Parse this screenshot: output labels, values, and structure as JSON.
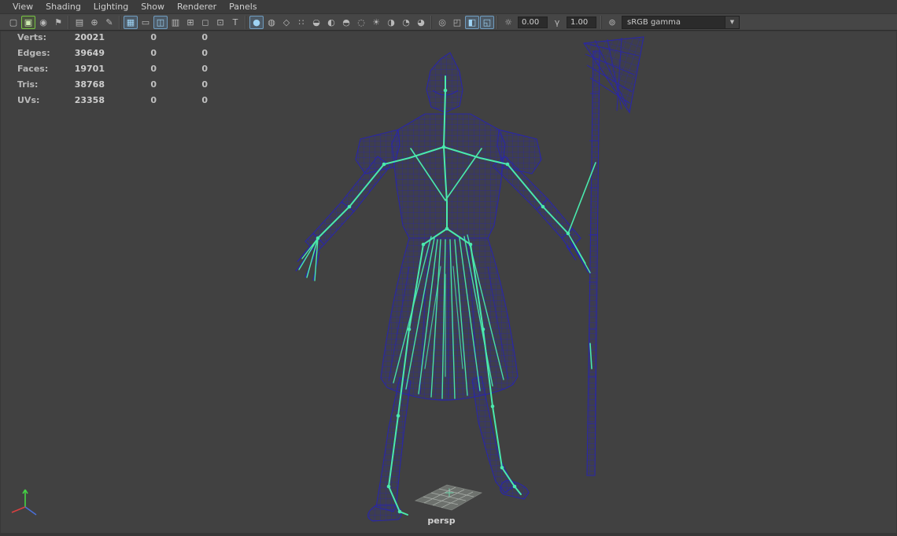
{
  "colors": {
    "viewport-bg": "#414141",
    "wire": "#2a27a6",
    "skeleton": "#4ae9ad",
    "ground": "#99a299",
    "axis-x": "#d94040",
    "axis-y": "#44d344",
    "axis-z": "#4a6fd8"
  },
  "menu": {
    "items": [
      {
        "name": "menu-view",
        "label": "View"
      },
      {
        "name": "menu-shading",
        "label": "Shading"
      },
      {
        "name": "menu-lighting",
        "label": "Lighting"
      },
      {
        "name": "menu-show",
        "label": "Show"
      },
      {
        "name": "menu-renderer",
        "label": "Renderer"
      },
      {
        "name": "menu-panels",
        "label": "Panels"
      }
    ]
  },
  "toolbar": {
    "groups": {
      "camera": [
        {
          "name": "select-camera-icon",
          "glyph": "▢"
        },
        {
          "name": "grab-view-icon",
          "glyph": "▣",
          "active": "green"
        },
        {
          "name": "camera-attributes-icon",
          "glyph": "◉"
        },
        {
          "name": "bookmark-icon",
          "glyph": "⚑"
        }
      ],
      "tools": [
        {
          "name": "image-plane-icon",
          "glyph": "▤"
        },
        {
          "name": "2d-pan-zoom-icon",
          "glyph": "⊕"
        },
        {
          "name": "pencil-icon",
          "glyph": "✎"
        }
      ],
      "gates": [
        {
          "name": "grid-icon",
          "glyph": "▦",
          "active": "blue"
        },
        {
          "name": "film-gate-icon",
          "glyph": "▭"
        },
        {
          "name": "resolution-gate-icon",
          "glyph": "◫",
          "active": "blue"
        },
        {
          "name": "gate-mask-icon",
          "glyph": "▥"
        },
        {
          "name": "field-chart-icon",
          "glyph": "⊞"
        },
        {
          "name": "safe-action-icon",
          "glyph": "◻"
        },
        {
          "name": "safe-title-icon",
          "glyph": "⊡"
        },
        {
          "name": "frame-text-icon",
          "glyph": "T"
        }
      ],
      "shading": [
        {
          "name": "smooth-shade-icon",
          "glyph": "●",
          "active": "blue"
        },
        {
          "name": "flat-shade-icon",
          "glyph": "◍"
        },
        {
          "name": "bounding-box-icon",
          "glyph": "◇"
        },
        {
          "name": "points-icon",
          "glyph": "∷"
        },
        {
          "name": "wireframe-on-shaded-icon",
          "glyph": "◒"
        },
        {
          "name": "textured-icon",
          "glyph": "◐"
        },
        {
          "name": "use-default-material-icon",
          "glyph": "◓"
        },
        {
          "name": "xray-icon",
          "glyph": "◌"
        },
        {
          "name": "lights-icon",
          "glyph": "☀"
        },
        {
          "name": "shadows-icon",
          "glyph": "◑"
        },
        {
          "name": "occlusion-icon",
          "glyph": "◔"
        },
        {
          "name": "motion-blur-icon",
          "glyph": "◕"
        }
      ],
      "layout": [
        {
          "name": "isolate-select-icon",
          "glyph": "◎"
        },
        {
          "name": "single-pane-icon",
          "glyph": "◰"
        },
        {
          "name": "split-pane-icon",
          "glyph": "◧",
          "active": "blue"
        },
        {
          "name": "quad-pane-icon",
          "glyph": "◱",
          "active": "blue"
        }
      ]
    },
    "exposure_icon": "☼",
    "exposure": "0.00",
    "gamma_icon": "γ",
    "gamma": "1.00",
    "cm_icon": "⊚",
    "colorspace": "sRGB gamma",
    "dropdown_arrow": "▼"
  },
  "hud": {
    "rows": [
      {
        "name": "hud-row-verts",
        "label": "Verts:",
        "value": "20021",
        "extra1": "0",
        "extra2": "0"
      },
      {
        "name": "hud-row-edges",
        "label": "Edges:",
        "value": "39649",
        "extra1": "0",
        "extra2": "0"
      },
      {
        "name": "hud-row-faces",
        "label": "Faces:",
        "value": "19701",
        "extra1": "0",
        "extra2": "0"
      },
      {
        "name": "hud-row-tris",
        "label": "Tris:",
        "value": "38768",
        "extra1": "0",
        "extra2": "0"
      },
      {
        "name": "hud-row-uvs",
        "label": "UVs:",
        "value": "23358",
        "extra1": "0",
        "extra2": "0"
      }
    ]
  },
  "viewport": {
    "camera": "persp"
  }
}
